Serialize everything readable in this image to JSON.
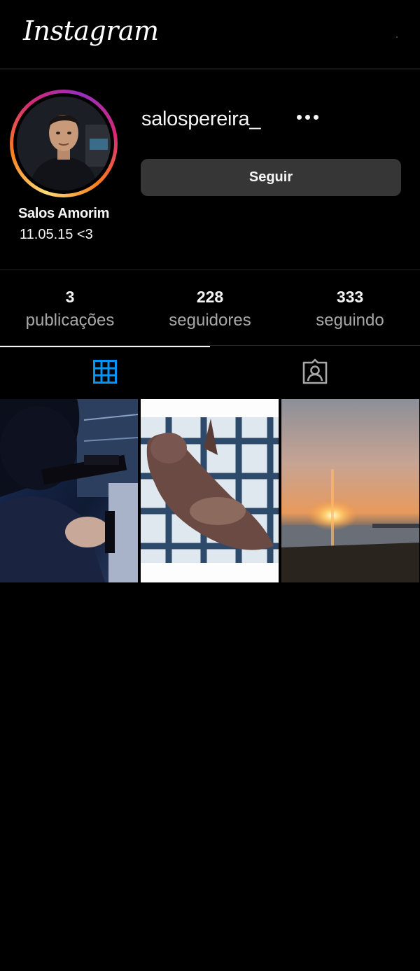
{
  "header": {
    "logo_text": "Instagram"
  },
  "profile": {
    "username": "salospereira_",
    "display_name": "Salos Amorim",
    "bio": "11.05.15 <3",
    "follow_label": "Seguir",
    "more_icon": "more-horizontal-icon"
  },
  "stats": [
    {
      "value": "3",
      "label": "publicações"
    },
    {
      "value": "228",
      "label": "seguidores"
    },
    {
      "value": "333",
      "label": "seguindo"
    }
  ],
  "tabs": [
    {
      "icon": "grid-icon",
      "active": true,
      "color": "#0095f6"
    },
    {
      "icon": "tagged-icon",
      "active": false,
      "color": "#a8a8a8"
    }
  ],
  "posts": [
    {
      "subject": "person-aiming-rifle"
    },
    {
      "subject": "cat-lying-on-tiles"
    },
    {
      "subject": "sunset-over-water"
    }
  ],
  "colors": {
    "background": "#000000",
    "button": "#363636",
    "accent": "#0095f6",
    "muted_text": "#a8a8a8"
  }
}
